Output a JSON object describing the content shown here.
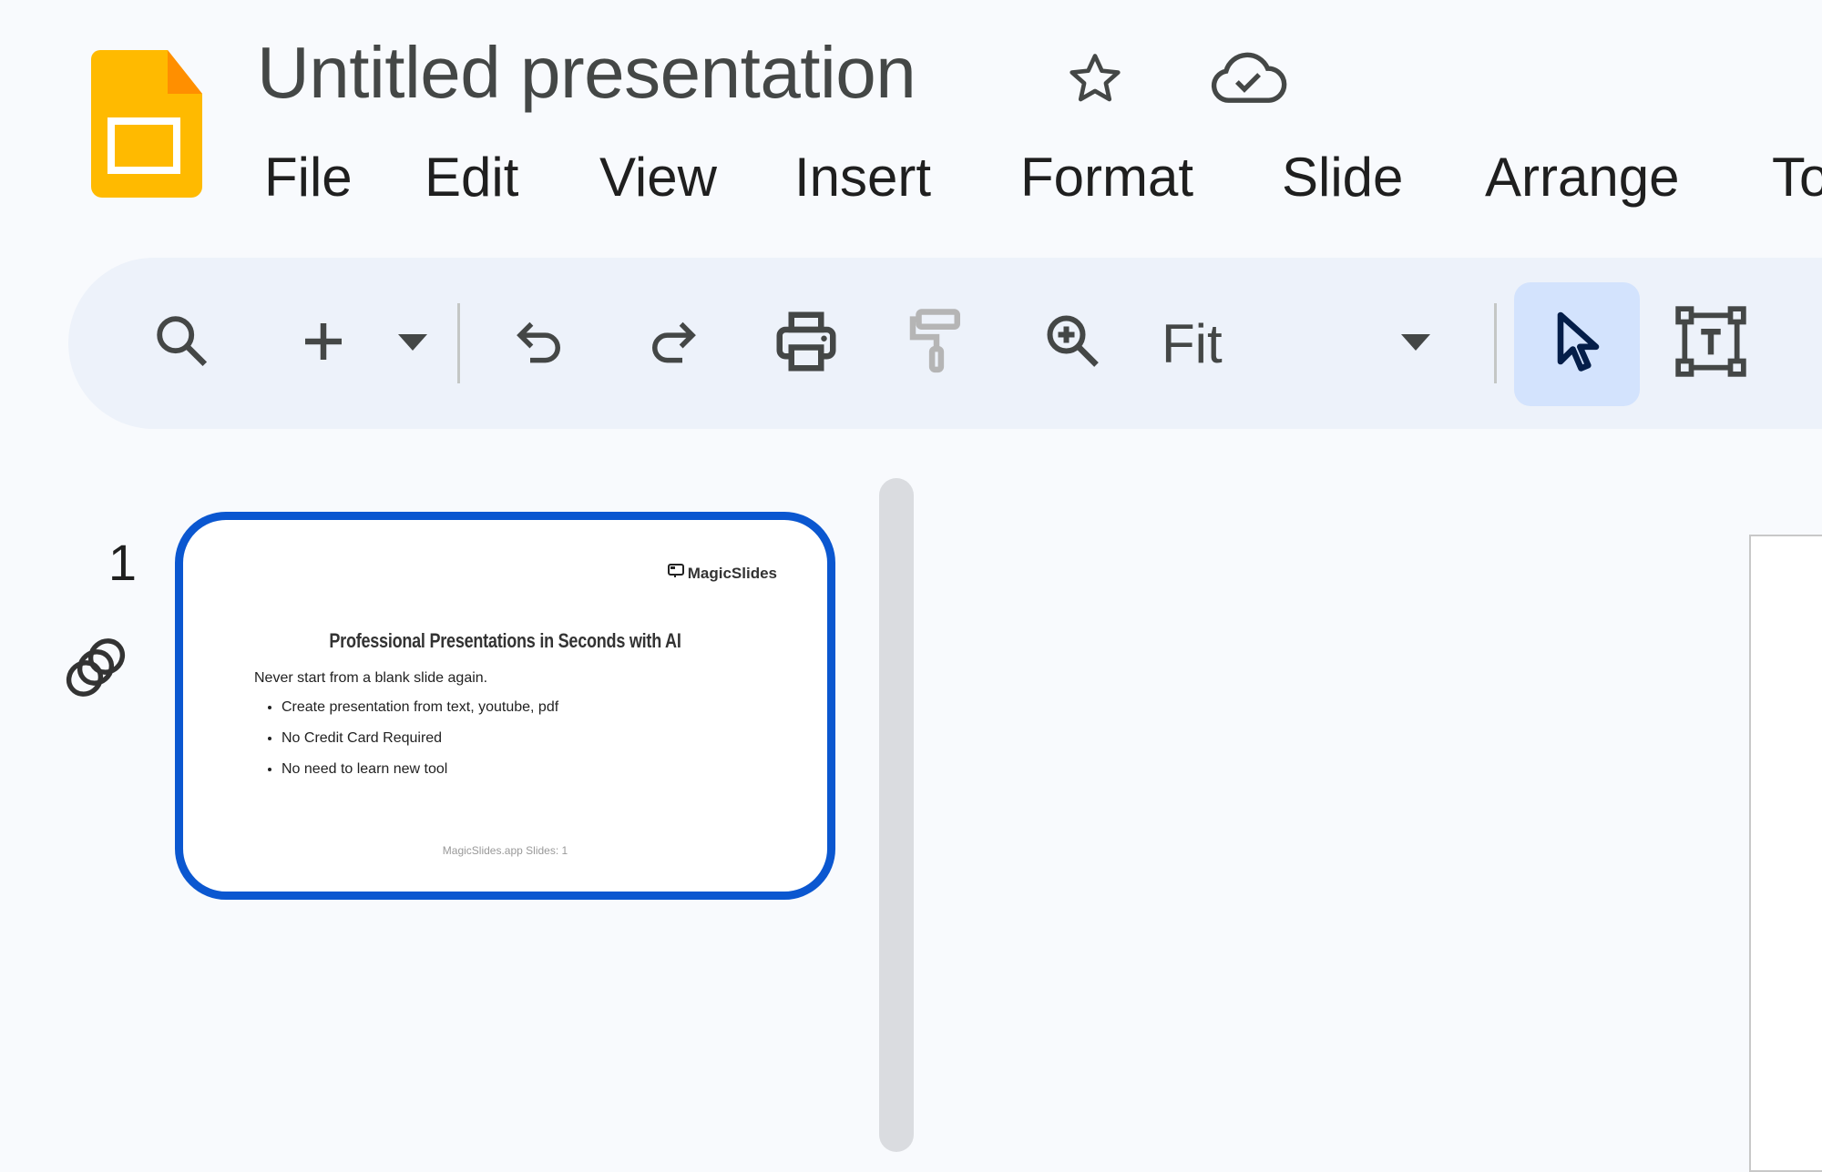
{
  "header": {
    "app_icon": "google-slides-logo",
    "title": "Untitled presentation",
    "star_icon": "star-outline-icon",
    "cloud_status_icon": "cloud-saved-icon"
  },
  "menu": {
    "items": [
      {
        "label": "File"
      },
      {
        "label": "Edit"
      },
      {
        "label": "View"
      },
      {
        "label": "Insert"
      },
      {
        "label": "Format"
      },
      {
        "label": "Slide"
      },
      {
        "label": "Arrange"
      },
      {
        "label": "Tools"
      }
    ]
  },
  "toolbar": {
    "search_icon": "search-icon",
    "new_slide_icon": "plus-icon",
    "new_slide_dropdown_icon": "caret-down-icon",
    "undo_icon": "undo-icon",
    "redo_icon": "redo-icon",
    "print_icon": "print-icon",
    "paint_format_icon": "paint-format-icon",
    "zoom_icon": "zoom-in-icon",
    "zoom_value": "Fit",
    "zoom_dropdown_icon": "caret-down-icon",
    "select_tool_icon": "cursor-icon",
    "select_tool_active": true,
    "textbox_icon": "text-box-icon"
  },
  "filmstrip": {
    "slides": [
      {
        "number": "1",
        "selected": true,
        "has_transition": true,
        "logo_text": "MagicSlides",
        "title": "Professional Presentations in Seconds with AI",
        "subtitle": "Never start from a blank slide again.",
        "bullets": [
          "Create presentation from text, youtube, pdf",
          "No Credit Card Required",
          "No need to learn new tool"
        ],
        "footer": "MagicSlides.app Slides: 1"
      }
    ]
  },
  "colors": {
    "accent": "#0b57d0",
    "toolbar_bg": "#edf2fa",
    "active_tool_bg": "#d3e3fd",
    "app_icon_yellow": "#ffba00",
    "app_icon_fold": "#ff8f00"
  }
}
